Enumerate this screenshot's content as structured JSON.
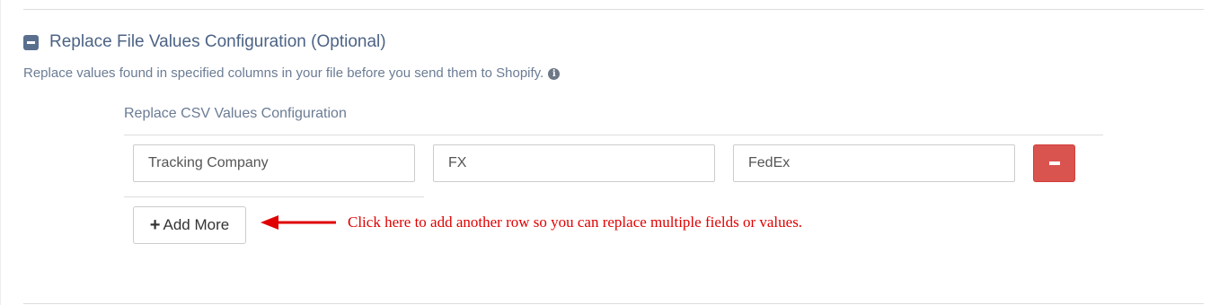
{
  "section": {
    "title": "Replace File Values Configuration (Optional)",
    "description": "Replace values found in specified columns in your file before you send them to Shopify.",
    "icons": {
      "toggle": "minus-square-icon",
      "info": "info-circle-icon"
    }
  },
  "replace_config": {
    "title": "Replace CSV Values Configuration",
    "rows": [
      {
        "column": "Tracking Company",
        "find": "FX",
        "replace": "FedEx"
      }
    ],
    "remove_button_icon": "minus-icon",
    "add_more_label": "Add More",
    "add_more_icon": "plus-icon"
  },
  "annotation": {
    "text": "Click here to add another row so you can replace multiple fields or values.",
    "color": "#e00000",
    "arrow_icon": "left-arrow-icon"
  },
  "colors": {
    "heading": "#4c6385",
    "danger": "#d9534f"
  }
}
